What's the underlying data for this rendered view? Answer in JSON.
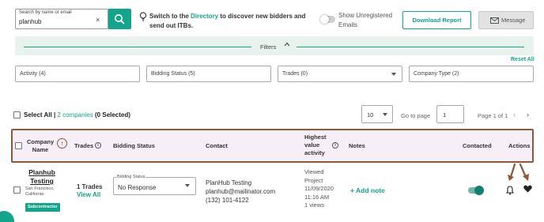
{
  "search": {
    "label": "Search by name or email",
    "value": "planhub",
    "clear_glyph": "×"
  },
  "tip": {
    "prefix": "Switch to the ",
    "link": "Directory",
    "suffix": " to discover new bidders and send out ITBs."
  },
  "unregistered_toggle": {
    "label": "Show Unregistered Emails",
    "on": false
  },
  "buttons": {
    "download": "Download Report",
    "message": "Message"
  },
  "filters": {
    "label": "Filters",
    "reset": "Reset All",
    "activity": "Activity (4)",
    "bidding_status": "Bidding Status (5)",
    "trades": "Trades (0)",
    "company_type": "Company Type (2)"
  },
  "selection": {
    "select_all": "Select All |",
    "count": "2 companies",
    "selected": "(0 Selected)"
  },
  "pagination": {
    "per_page": "10",
    "goto_label": "Go to page",
    "goto_value": "1",
    "page_of": "Page 1 of 1",
    "prev": "‹",
    "next": "›"
  },
  "columns": {
    "company": "Company Name",
    "trades": "Trades",
    "bidding_status": "Bidding Status",
    "contact": "Contact",
    "highest": "Highest value activity",
    "notes": "Notes",
    "contacted": "Contacted",
    "actions": "Actions",
    "sort_glyph": "↑"
  },
  "row": {
    "company_name": "Planhub Testing",
    "location": "San Francisco, California",
    "badge": "Subcontractor",
    "trades": "1 Trades",
    "view_all": "View All",
    "bidding_legend": "Bidding Status",
    "bidding_value": "No Response",
    "contact_name": "PlanHub Testing",
    "contact_email": "planhub@mailinator.com",
    "contact_phone": "(132) 101-4122",
    "activity_1": "Viewed",
    "activity_2": "Project",
    "activity_date": "11/09/2020",
    "activity_time": "11:16 AM",
    "activity_views": "1 views",
    "add_note": "+ Add note",
    "contacted": true
  },
  "colors": {
    "accent": "#12a58b",
    "header_bg": "#f7eff7",
    "annotation": "#8b5a3c"
  }
}
